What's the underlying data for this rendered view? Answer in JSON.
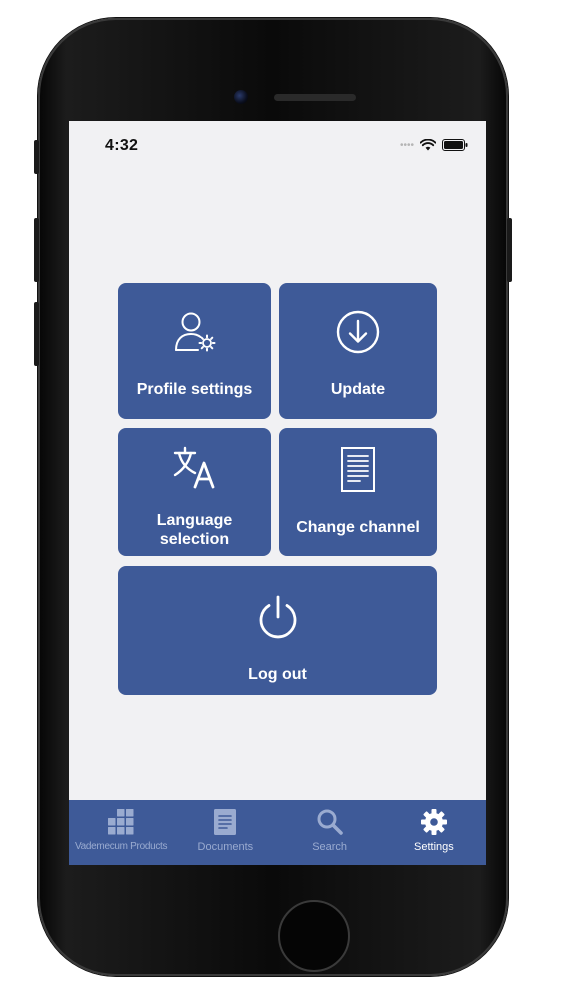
{
  "status_bar": {
    "time": "4:32",
    "signal_icon": "signal-dots-icon",
    "wifi_icon": "wifi-icon",
    "battery_icon": "battery-icon"
  },
  "menu": {
    "profile_settings": {
      "label": "Profile settings",
      "icon": "user-settings-icon"
    },
    "update": {
      "label": "Update",
      "icon": "download-circle-icon"
    },
    "language_selection": {
      "label_line1": "Language",
      "label_line2": "selection",
      "icon": "translate-icon"
    },
    "change_channel": {
      "label": "Change channel",
      "icon": "document-icon"
    },
    "log_out": {
      "label": "Log out",
      "icon": "power-icon"
    }
  },
  "tabbar": {
    "active": "Settings",
    "tabs": [
      {
        "label": "Vademecum Products",
        "icon": "grid-icon"
      },
      {
        "label": "Documents",
        "icon": "document-icon"
      },
      {
        "label": "Search",
        "icon": "search-icon"
      },
      {
        "label": "Settings",
        "icon": "gear-icon"
      }
    ]
  },
  "colors": {
    "accent": "#3e5a98",
    "screen_background": "#f1f1f3",
    "tab_inactive": "#9aabd0",
    "tab_active": "#ffffff"
  }
}
